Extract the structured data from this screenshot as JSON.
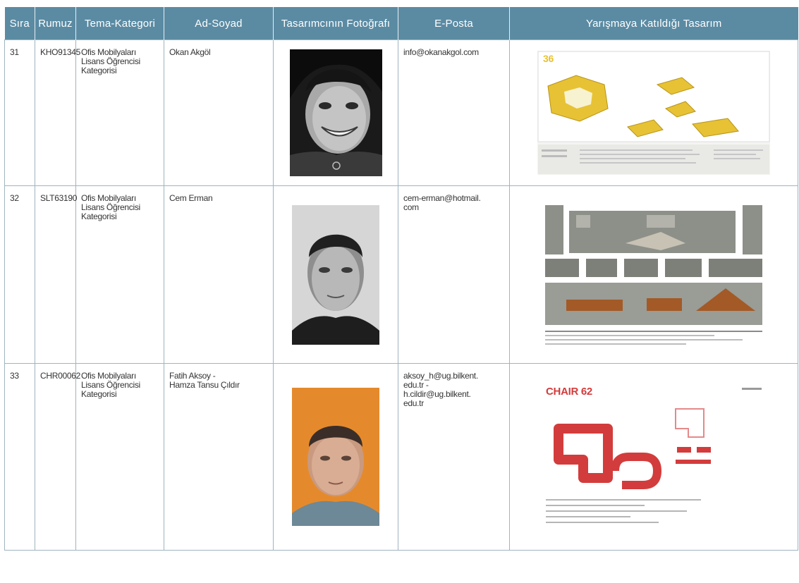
{
  "headers": [
    "Sıra",
    "Rumuz",
    "Tema-Kategori",
    "Ad-Soyad",
    "Tasarımcının Fotoğrafı",
    "E-Posta",
    "Yarışmaya Katıldığı Tasarım"
  ],
  "rows": [
    {
      "sira": "31",
      "rumuz": "KHO91345",
      "kategori": [
        "Ofis Mobilyaları",
        "Lisans Öğrencisi",
        "Kategorisi"
      ],
      "ad": [
        "Okan Akgöl"
      ],
      "email": [
        "info@okanakgol.com"
      ]
    },
    {
      "sira": "32",
      "rumuz": "SLT63190",
      "kategori": [
        "Ofis Mobilyaları",
        "Lisans Öğrencisi",
        "Kategorisi"
      ],
      "ad": [
        "Cem Erman"
      ],
      "email": [
        "cem-erman@hotmail.",
        "com"
      ]
    },
    {
      "sira": "33",
      "rumuz": "CHR00062",
      "kategori": [
        "Ofis Mobilyaları",
        "Lisans Öğrencisi",
        "Kategorisi"
      ],
      "ad": [
        "Fatih Aksoy -",
        "Hamza Tansu Çıldır"
      ],
      "email": [
        "aksoy_h@ug.bilkent.",
        "edu.tr -",
        "h.cildir@ug.bilkent.",
        "edu.tr"
      ]
    }
  ],
  "design_texts": {
    "row31_logo": "36",
    "row33_logo": "CHAIR 62"
  },
  "colors": {
    "header_bg": "#5b8ba3",
    "header_text": "#ffffff",
    "border": "#9fb4c0",
    "accent_yellow": "#e7c234",
    "accent_red": "#d33c3c",
    "photo_bg_orange": "#e58a2c"
  }
}
